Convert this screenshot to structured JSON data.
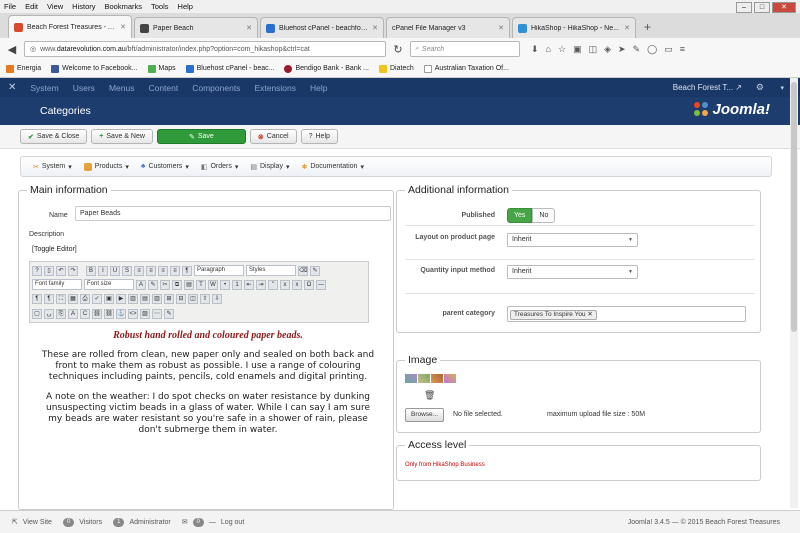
{
  "browser": {
    "menu": [
      "File",
      "Edit",
      "View",
      "History",
      "Bookmarks",
      "Tools",
      "Help"
    ],
    "tabs": [
      {
        "title": "Beach Forest Treasures - A...",
        "color": "#d94a2e"
      },
      {
        "title": "Paper Beach",
        "color": "#444"
      },
      {
        "title": "Bluehost cPanel - beachfor...",
        "color": "#2a6fcf"
      },
      {
        "title": "cPanel File Manager v3",
        "color": "#888"
      },
      {
        "title": "HikaShop - HikaShop - Ne...",
        "color": "#2f8fd8"
      }
    ],
    "url_prefix": "www.",
    "url_domain": "datarevolution.com.au",
    "url_path": "/bft/administrator/index.php?option=com_hikashop&ctrl=cat",
    "search_placeholder": "Search",
    "bookmarks": [
      {
        "label": "Energia",
        "color": "#e87a1d"
      },
      {
        "label": "Welcome to Facebook...",
        "color": "#3b5998"
      },
      {
        "label": "Maps",
        "color": "#4caf50"
      },
      {
        "label": "Bluehost cPanel - beac...",
        "color": "#2a6fcf"
      },
      {
        "label": "Bendigo Bank - Bank ...",
        "color": "#9b1c2e"
      },
      {
        "label": "Diatech",
        "color": "#f0c419"
      },
      {
        "label": "Australian Taxation Of...",
        "color": "#ffffff"
      }
    ]
  },
  "joomla": {
    "topmenu": [
      "System",
      "Users",
      "Menus",
      "Content",
      "Components",
      "Extensions",
      "Help"
    ],
    "site_name": "Beach Forest T...",
    "page_title": "Categories",
    "logo_text": "Joomla!",
    "toolbar": {
      "save_close": "Save & Close",
      "save_new": "Save & New",
      "save": "Save",
      "cancel": "Cancel",
      "help": "Help"
    },
    "hikamenu": [
      "System",
      "Products",
      "Customers",
      "Orders",
      "Display",
      "Documentation"
    ]
  },
  "main_info": {
    "legend": "Main information",
    "name_label": "Name",
    "name_value": "Paper Beads",
    "description_label": "Description",
    "toggle_editor": "[Toggle Editor]",
    "paragraph_select": "Paragraph",
    "styles_select": "Styles",
    "font_family_select": "Font family",
    "font_size_select": "Font size",
    "heading": "Robust hand rolled and coloured paper beads.",
    "para1": "These are rolled from clean, new paper only and sealed on both back and front to make them as robust as possible. I use a range of colouring techniques including paints, pencils, cold enamels and digital printing.",
    "para2": "A note on the weather: I do spot checks on water resistance by dunking unsuspecting victim beads in a glass of water. While I can say I am sure my beads are water resistant so you're safe in a shower of rain, please don't submerge them in water."
  },
  "additional_info": {
    "legend": "Additional information",
    "published_label": "Published",
    "yes": "Yes",
    "no": "No",
    "layout_label": "Layout on product page",
    "layout_value": "Inherit",
    "qty_label": "Quantity input method",
    "qty_value": "Inherit",
    "parent_label": "parent category",
    "parent_value": "Treasures To Inspire You"
  },
  "image": {
    "legend": "Image",
    "browse": "Browse...",
    "no_file": "No file selected.",
    "max_upload": "maximum upload file size : 50M"
  },
  "access": {
    "legend": "Access level",
    "text": "Only from HikaShop Business"
  },
  "status": {
    "view_site": "View Site",
    "visitors_count": "0",
    "visitors": "Visitors",
    "admin_count": "1",
    "administrator": "Administrator",
    "msg_count": "0",
    "logout": "Log out",
    "footer": "Joomla! 3.4.5 — © 2015 Beach Forest Treasures"
  }
}
